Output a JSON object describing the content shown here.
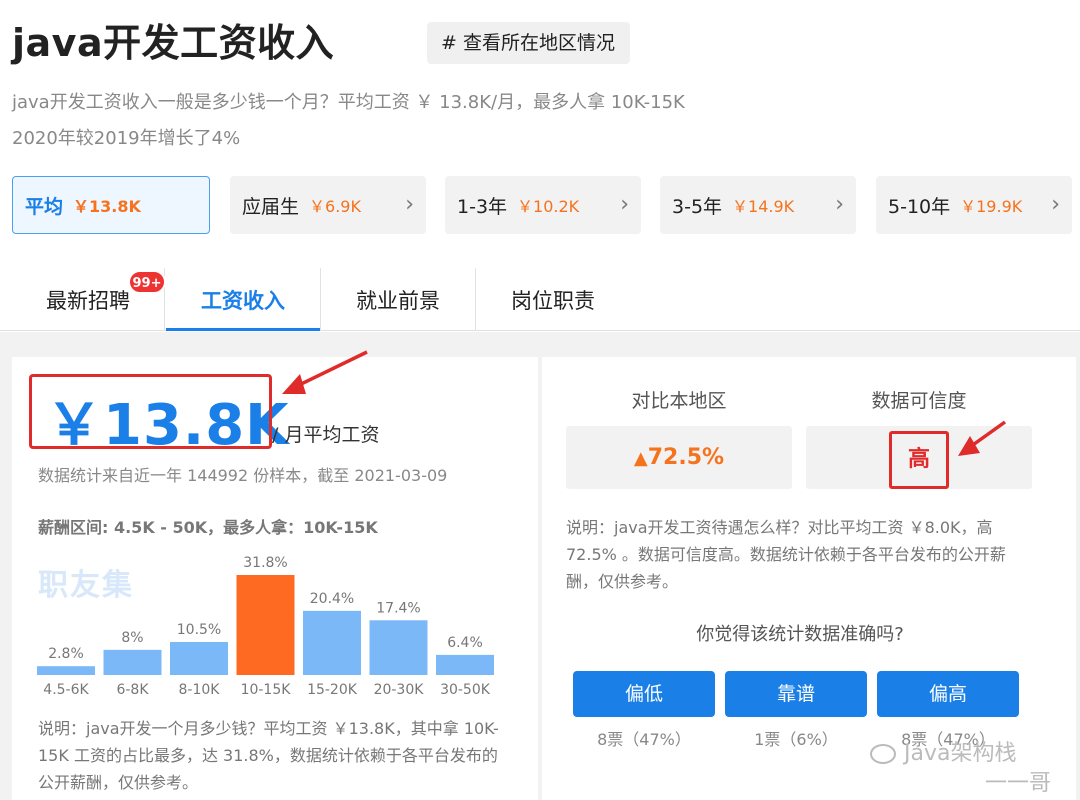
{
  "header": {
    "title": "java开发工资收入",
    "region_chip": "# 查看所在地区情况",
    "description": "java开发工资收入一般是多少钱一个月？平均工资 ￥ 13.8K/月，最多人拿 10K-15K",
    "growth": "2020年较2019年增长了4%"
  },
  "filters": [
    {
      "label": "平均",
      "value": "￥13.8K"
    },
    {
      "label": "应届生",
      "value": "￥6.9K"
    },
    {
      "label": "1-3年",
      "value": "￥10.2K"
    },
    {
      "label": "3-5年",
      "value": "￥14.9K"
    },
    {
      "label": "5-10年",
      "value": "￥19.9K"
    }
  ],
  "tabs": [
    {
      "label": "最新招聘"
    },
    {
      "label": "工资收入"
    },
    {
      "label": "就业前景"
    },
    {
      "label": "岗位职责"
    }
  ],
  "badge": "99+",
  "salary": {
    "amount": "￥13.8K",
    "unit_label": "/ 月平均工资",
    "source": "数据统计来自近一年 144992 份样本，截至 2021-03-09",
    "range": "薪酬区间: 4.5K - 50K，最多人拿：10K-15K",
    "watermark": "职友集",
    "note": "说明：java开发一个月多少钱？平均工资 ￥13.8K，其中拿 10K-15K 工资的占比最多，达 31.8%，数据统计依赖于各平台发布的公开薪酬，仅供参考。"
  },
  "chart_data": {
    "type": "bar",
    "categories": [
      "4.5-6K",
      "6-8K",
      "8-10K",
      "10-15K",
      "15-20K",
      "20-30K",
      "30-50K"
    ],
    "values": [
      2.8,
      8,
      10.5,
      31.8,
      20.4,
      17.4,
      6.4
    ],
    "labels": [
      "2.8%",
      "8%",
      "10.5%",
      "31.8%",
      "20.4%",
      "17.4%",
      "6.4%"
    ],
    "highlight_index": 3,
    "colors": {
      "normal": "#7bb8f7",
      "highlight": "#fe6a22"
    },
    "title": "",
    "xlabel": "",
    "ylabel": ""
  },
  "comparison": {
    "compare_header": "对比本地区",
    "credibility_header": "数据可信度",
    "compare_value": "72.5%",
    "credibility_value": "高",
    "note": "说明：java开发工资待遇怎么样？对比平均工资 ￥8.0K，高 72.5% 。数据可信度高。数据统计依赖于各平台发布的公开薪酬，仅供参考。",
    "question": "你觉得该统计数据准确吗?"
  },
  "votes": [
    {
      "label": "偏低",
      "count": "8票（47%）"
    },
    {
      "label": "靠谱",
      "count": "1票（6%）"
    },
    {
      "label": "偏高",
      "count": "8票（47%）"
    }
  ],
  "footer_watermark": {
    "line1": "Java架构栈",
    "line2": "一一哥"
  },
  "colors": {
    "accent": "#1a7fe6",
    "orange": "#f5731e",
    "red": "#e02b2b"
  }
}
